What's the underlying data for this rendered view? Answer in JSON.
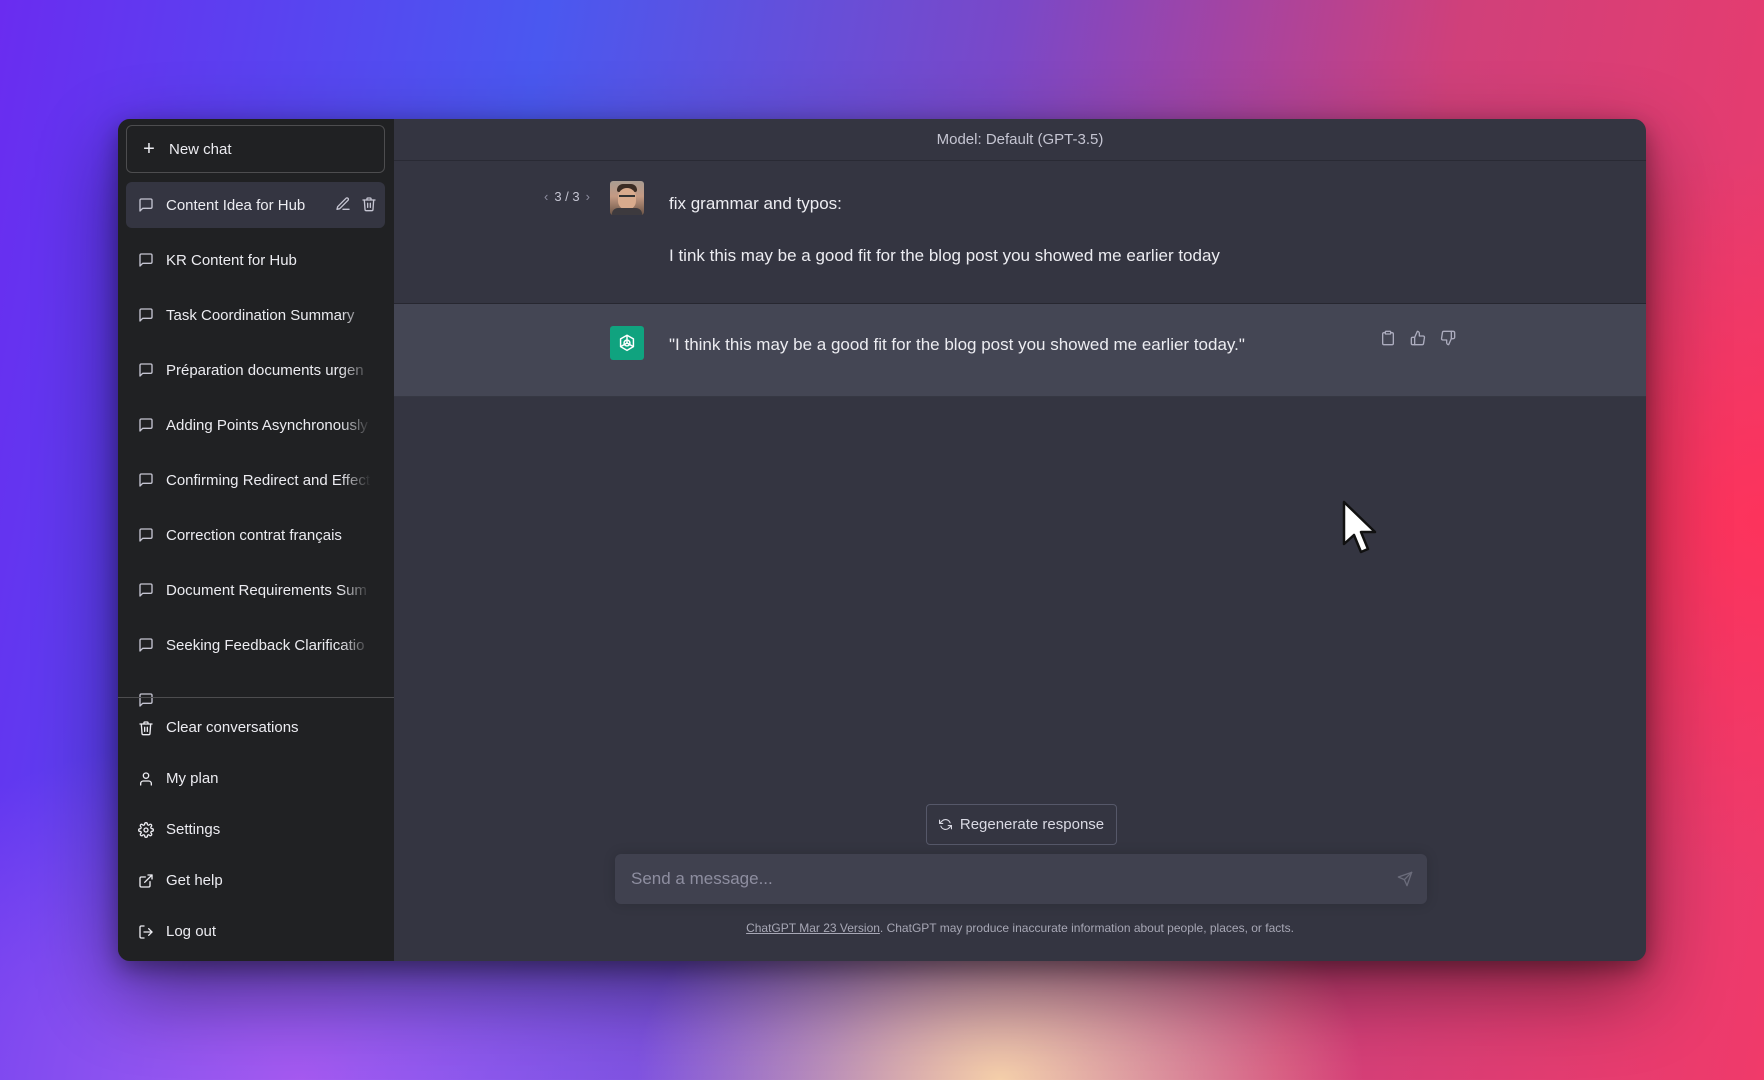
{
  "sidebar": {
    "new_chat_label": "New chat",
    "conversations": [
      {
        "label": "Content Idea for Hub"
      },
      {
        "label": "KR Content for Hub"
      },
      {
        "label": "Task Coordination Summary"
      },
      {
        "label": "Préparation documents urgen"
      },
      {
        "label": "Adding Points Asynchronously"
      },
      {
        "label": "Confirming Redirect and Effect"
      },
      {
        "label": "Correction contrat français"
      },
      {
        "label": "Document Requirements Sum"
      },
      {
        "label": "Seeking Feedback Clarificatio"
      }
    ],
    "menu": {
      "clear": "Clear conversations",
      "plan": "My plan",
      "settings": "Settings",
      "help": "Get help",
      "logout": "Log out"
    }
  },
  "header": {
    "model": "Model: Default (GPT-3.5)"
  },
  "conversation": {
    "pager": {
      "prev": "‹",
      "label": "3 / 3",
      "next": "›"
    },
    "user_lines": [
      "fix grammar and typos:",
      "I tink this may be a good fit for the blog post you showed me earlier today"
    ],
    "assistant_text": "\"I think this may be a good fit for the blog post you showed me earlier today.\""
  },
  "composer": {
    "regenerate_label": "Regenerate response",
    "placeholder": "Send a message..."
  },
  "footer": {
    "link_text": "ChatGPT Mar 23 Version",
    "note": ". ChatGPT may produce inaccurate information about people, places, or facts."
  },
  "colors": {
    "sidebar_bg": "#202123",
    "main_bg": "#343541",
    "assistant_bg": "#444654",
    "brand_green": "#10a37f"
  }
}
